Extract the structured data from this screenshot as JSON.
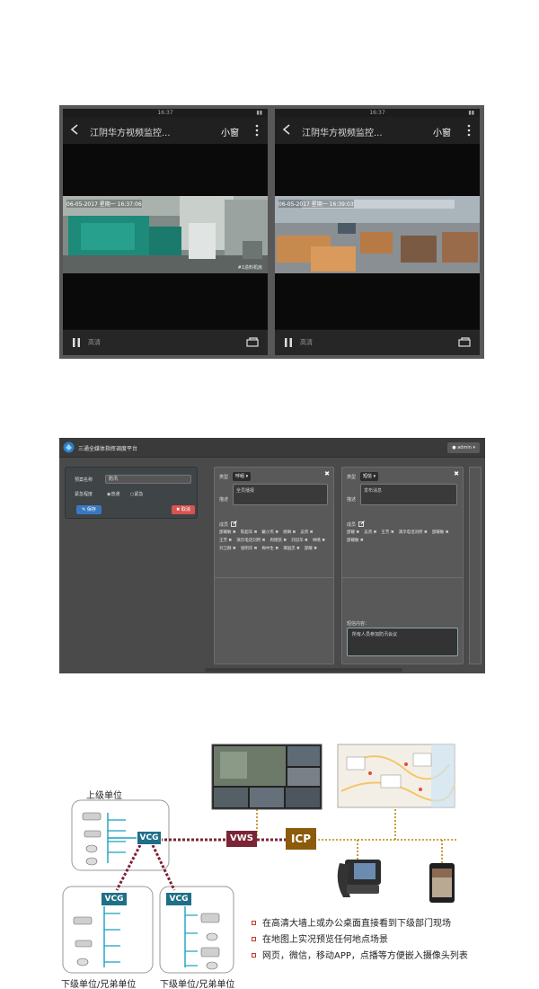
{
  "phones": [
    {
      "status_time": "16:37",
      "title": "江阴华方视频监控...",
      "quality": "小窗",
      "osd": "06-05-2017 星期一 16:37:06",
      "cam_label": "#1造料机房",
      "hd_label": "高清"
    },
    {
      "status_time": "16:37",
      "title": "江阴华方视频监控...",
      "quality": "小窗",
      "osd": "06-05-2017 星期一 16:39:03",
      "cam_label": "",
      "hd_label": "高清"
    }
  ],
  "web": {
    "app_title": "三通全媒体指挥调度平台",
    "admin": "admin",
    "form": {
      "plan_name_label": "预案名称",
      "plan_name_value": "防汛",
      "emergency_label": "紧急程度",
      "option_normal": "普通",
      "option_urgent": "紧急",
      "save": "保存",
      "cancel": "取消"
    },
    "cards": [
      {
        "type_label": "类型",
        "type_value": "呼组",
        "desc_label": "描述",
        "desc_value": "全员播报",
        "members_label": "成员",
        "members": [
          "邵耀敏",
          "陈超军",
          "戴小杰",
          "杨琳",
          "吴贤",
          "王芳",
          "演示电话刘所",
          "周德凯",
          "刘冠华",
          "林晴",
          "刘卫群",
          "张明华",
          "梅中生",
          "谭国忠",
          "邵耀"
        ],
        "broadcast_label": "",
        "broadcast_value": ""
      },
      {
        "type_label": "类型",
        "type_value": "短信",
        "desc_label": "描述",
        "desc_value": "发布消息",
        "members_label": "成员",
        "members": [
          "邵耀",
          "吴贤",
          "王芳",
          "演示电话刘所",
          "邵耀敏",
          "邵耀敏"
        ],
        "broadcast_label": "短信内容：",
        "broadcast_value": "所有人员参加防汛会议"
      }
    ]
  },
  "diagram": {
    "upper_unit": "上级单位",
    "lower_unit_left": "下级单位/兄弟单位",
    "lower_unit_right": "下级单位/兄弟单位",
    "vcg": "VCG",
    "vws": "VWS",
    "icp": "ICP",
    "bullets": [
      "在高清大墙上或办公桌面直接看到下级部门现场",
      "在地图上实况预览任何地点场景",
      "网页，微信，移动APP，点播等方便嵌入摄像头列表"
    ],
    "colors": {
      "vcg": "#1f6f87",
      "vws": "#7b2436",
      "icp": "#8b5a0a",
      "link_dotted": "#7b2436",
      "link_gold": "#b8860b",
      "tree_line": "#1a9fc0"
    }
  }
}
